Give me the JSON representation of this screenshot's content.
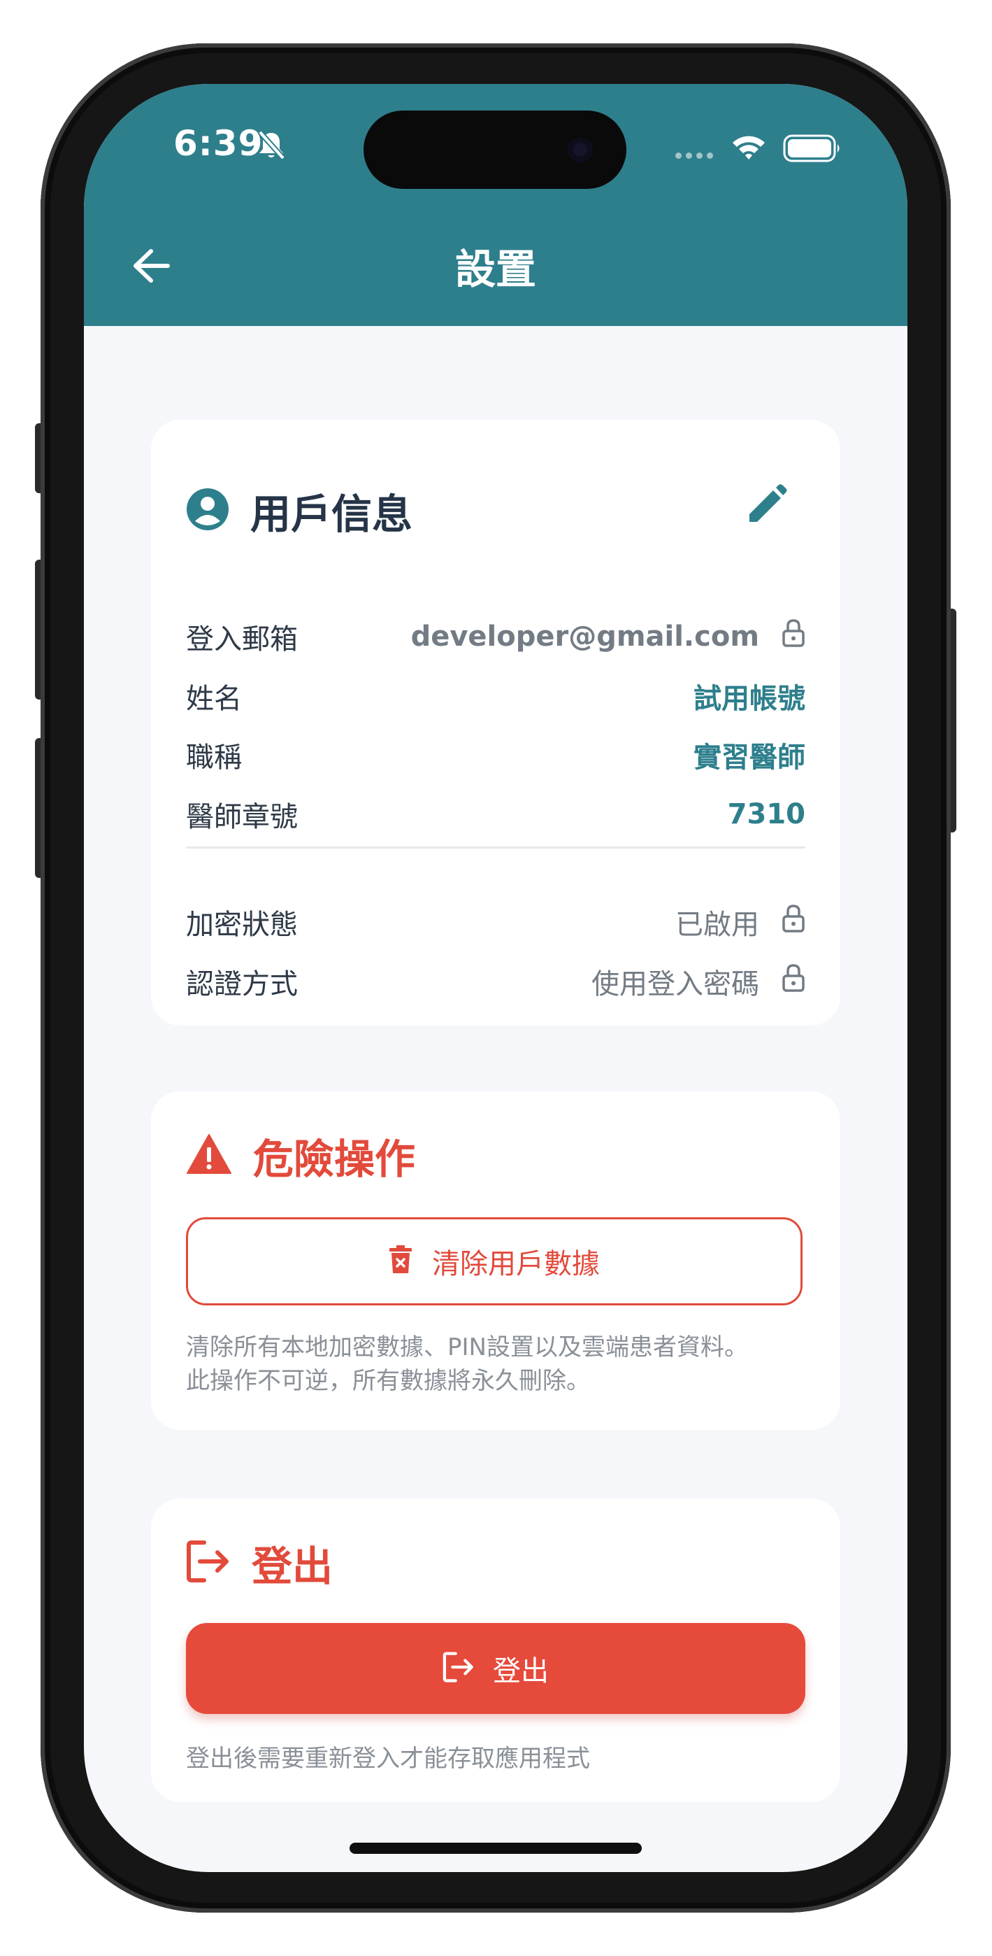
{
  "status_bar": {
    "time": "6:39"
  },
  "header": {
    "title": "設置"
  },
  "user_card": {
    "title": "用戶信息",
    "rows": [
      {
        "label": "登入郵箱",
        "value": "developer@gmail.com"
      },
      {
        "label": "姓名",
        "value": "試用帳號"
      },
      {
        "label": "職稱",
        "value": "實習醫師"
      },
      {
        "label": "醫師章號",
        "value": "7310"
      }
    ],
    "security_rows": [
      {
        "label": "加密狀態",
        "value": "已啟用"
      },
      {
        "label": "認證方式",
        "value": "使用登入密碼"
      }
    ]
  },
  "danger_card": {
    "title": "危險操作",
    "button_label": "清除用戶數據",
    "note_line1": "清除所有本地加密數據、PIN設置以及雲端患者資料。",
    "note_line2": "此操作不可逆，所有數據將永久刪除。"
  },
  "logout_card": {
    "title": "登出",
    "button_label": "登出",
    "note": "登出後需要重新登入才能存取應用程式"
  },
  "colors": {
    "header_bg": "#2e7f8c",
    "accent": "#2e7f8c",
    "danger": "#e24a3b",
    "background": "#f5f7fa"
  },
  "icons": [
    "arrow-left-icon",
    "bell-slash-icon",
    "wifi-icon",
    "battery-icon",
    "user-circle-icon",
    "pencil-icon",
    "lock-icon",
    "warning-triangle-icon",
    "trash-icon",
    "logout-icon"
  ]
}
